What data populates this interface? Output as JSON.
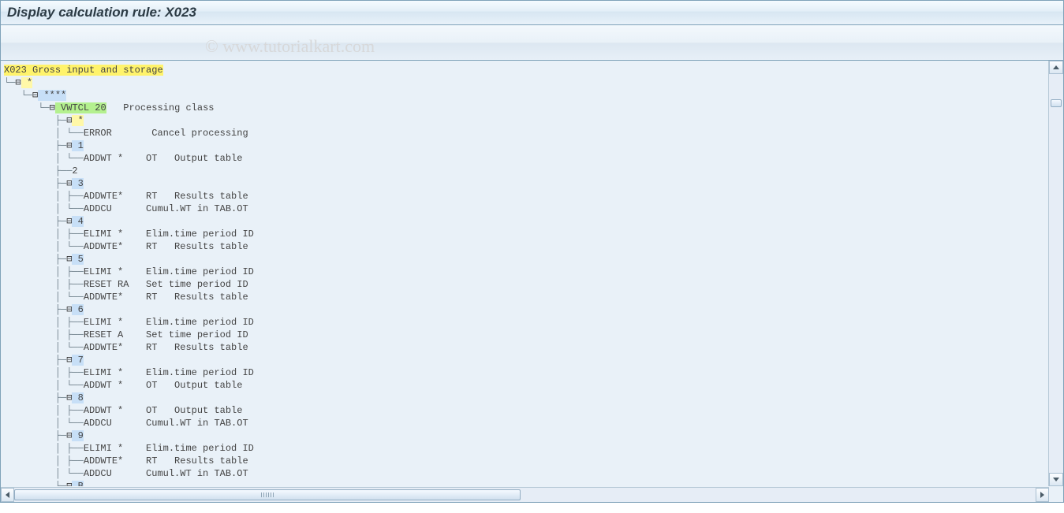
{
  "title": "Display calculation rule: X023",
  "watermark": "© www.tutorialkart.com",
  "root": {
    "code": "X023",
    "desc": "Gross input and storage"
  },
  "tree_lines": [
    {
      "indent": 0,
      "connector": "└─",
      "marker": "⊟",
      "text": " *",
      "hl": "lightyellow"
    },
    {
      "indent": 1,
      "connector": "└─",
      "marker": "⊟",
      "text": " ****",
      "hl": "lightblue"
    },
    {
      "indent": 2,
      "connector": "└─",
      "marker": "⊟",
      "text": " VWTCL 20   Processing class",
      "hl": "green",
      "hl_len": 9
    },
    {
      "indent": 3,
      "connector": "├─",
      "marker": "⊟",
      "text": " *",
      "hl": "lightyellow"
    },
    {
      "indent": 3,
      "connector": "│ └──",
      "marker": "",
      "text": "ERROR       Cancel processing"
    },
    {
      "indent": 3,
      "connector": "├─",
      "marker": "⊟",
      "text": " 1",
      "hl": "lightblue"
    },
    {
      "indent": 3,
      "connector": "│ └──",
      "marker": "",
      "text": "ADDWT *    OT   Output table"
    },
    {
      "indent": 3,
      "connector": "├──",
      "marker": "",
      "text": "2"
    },
    {
      "indent": 3,
      "connector": "├─",
      "marker": "⊟",
      "text": " 3",
      "hl": "lightblue"
    },
    {
      "indent": 3,
      "connector": "│ ├──",
      "marker": "",
      "text": "ADDWTE*    RT   Results table"
    },
    {
      "indent": 3,
      "connector": "│ └──",
      "marker": "",
      "text": "ADDCU      Cumul.WT in TAB.OT"
    },
    {
      "indent": 3,
      "connector": "├─",
      "marker": "⊟",
      "text": " 4",
      "hl": "lightblue"
    },
    {
      "indent": 3,
      "connector": "│ ├──",
      "marker": "",
      "text": "ELIMI *    Elim.time period ID"
    },
    {
      "indent": 3,
      "connector": "│ └──",
      "marker": "",
      "text": "ADDWTE*    RT   Results table"
    },
    {
      "indent": 3,
      "connector": "├─",
      "marker": "⊟",
      "text": " 5",
      "hl": "lightblue"
    },
    {
      "indent": 3,
      "connector": "│ ├──",
      "marker": "",
      "text": "ELIMI *    Elim.time period ID"
    },
    {
      "indent": 3,
      "connector": "│ ├──",
      "marker": "",
      "text": "RESET RA   Set time period ID"
    },
    {
      "indent": 3,
      "connector": "│ └──",
      "marker": "",
      "text": "ADDWTE*    RT   Results table"
    },
    {
      "indent": 3,
      "connector": "├─",
      "marker": "⊟",
      "text": " 6",
      "hl": "lightblue"
    },
    {
      "indent": 3,
      "connector": "│ ├──",
      "marker": "",
      "text": "ELIMI *    Elim.time period ID"
    },
    {
      "indent": 3,
      "connector": "│ ├──",
      "marker": "",
      "text": "RESET A    Set time period ID"
    },
    {
      "indent": 3,
      "connector": "│ └──",
      "marker": "",
      "text": "ADDWTE*    RT   Results table"
    },
    {
      "indent": 3,
      "connector": "├─",
      "marker": "⊟",
      "text": " 7",
      "hl": "lightblue"
    },
    {
      "indent": 3,
      "connector": "│ ├──",
      "marker": "",
      "text": "ELIMI *    Elim.time period ID"
    },
    {
      "indent": 3,
      "connector": "│ └──",
      "marker": "",
      "text": "ADDWT *    OT   Output table"
    },
    {
      "indent": 3,
      "connector": "├─",
      "marker": "⊟",
      "text": " 8",
      "hl": "lightblue"
    },
    {
      "indent": 3,
      "connector": "│ ├──",
      "marker": "",
      "text": "ADDWT *    OT   Output table"
    },
    {
      "indent": 3,
      "connector": "│ └──",
      "marker": "",
      "text": "ADDCU      Cumul.WT in TAB.OT"
    },
    {
      "indent": 3,
      "connector": "├─",
      "marker": "⊟",
      "text": " 9",
      "hl": "lightblue"
    },
    {
      "indent": 3,
      "connector": "│ ├──",
      "marker": "",
      "text": "ELIMI *    Elim.time period ID"
    },
    {
      "indent": 3,
      "connector": "│ ├──",
      "marker": "",
      "text": "ADDWTE*    RT   Results table"
    },
    {
      "indent": 3,
      "connector": "│ └──",
      "marker": "",
      "text": "ADDCU      Cumul.WT in TAB.OT"
    },
    {
      "indent": 3,
      "connector": "├─",
      "marker": "⊟",
      "text": " B",
      "hl": "lightblue"
    }
  ]
}
